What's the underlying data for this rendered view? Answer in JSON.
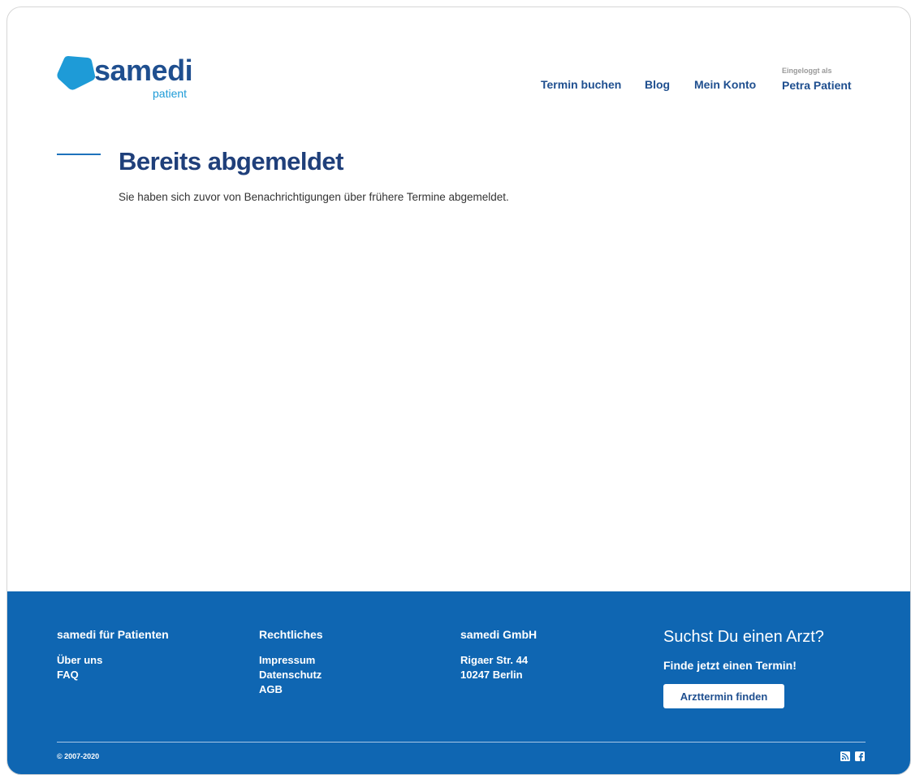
{
  "logo": {
    "word": "samedi",
    "sub": "patient",
    "color_primary": "#1f4f8f",
    "color_accent": "#1e9bd7"
  },
  "nav": {
    "termin": "Termin buchen",
    "blog": "Blog",
    "konto": "Mein Konto",
    "user_label": "Eingeloggt als",
    "user_name": "Petra Patient"
  },
  "main": {
    "title": "Bereits abgemeldet",
    "text": "Sie haben sich zuvor von Benachrichtigungen über frühere Termine abgemeldet."
  },
  "footer": {
    "background": "#0f66b2",
    "col1": {
      "heading": "samedi für Patienten",
      "links": [
        "Über uns",
        "FAQ"
      ]
    },
    "col2": {
      "heading": "Rechtliches",
      "links": [
        "Impressum",
        "Datenschutz",
        "AGB"
      ]
    },
    "col3": {
      "heading": "samedi GmbH",
      "lines": [
        "Rigaer Str. 44",
        "10247 Berlin"
      ]
    },
    "cta": {
      "title": "Suchst Du einen Arzt?",
      "subtitle": "Finde jetzt einen Termin!",
      "button": "Arzttermin finden"
    },
    "copyright": "© 2007-2020",
    "social_icons": [
      "rss-icon",
      "facebook-icon"
    ]
  }
}
